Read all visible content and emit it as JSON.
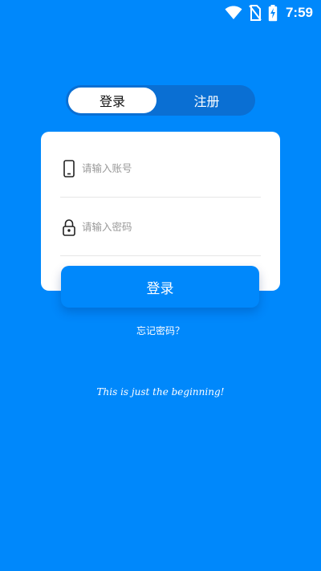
{
  "status_bar": {
    "time": "7:59",
    "icons": [
      "wifi-icon",
      "no-sim-icon",
      "battery-charging-icon"
    ]
  },
  "tabs": [
    {
      "label": "登录",
      "active": true
    },
    {
      "label": "注册",
      "active": false
    }
  ],
  "form": {
    "account": {
      "placeholder": "请输入账号",
      "value": "",
      "icon": "phone-icon"
    },
    "password": {
      "placeholder": "请输入密码",
      "value": "",
      "icon": "lock-icon"
    },
    "submit_label": "登录"
  },
  "forgot_password": "忘记密码？",
  "tagline": "This is just the beginning!",
  "colors": {
    "background": "#0088fb",
    "tab_track": "#0a6fd3",
    "card": "#ffffff"
  }
}
